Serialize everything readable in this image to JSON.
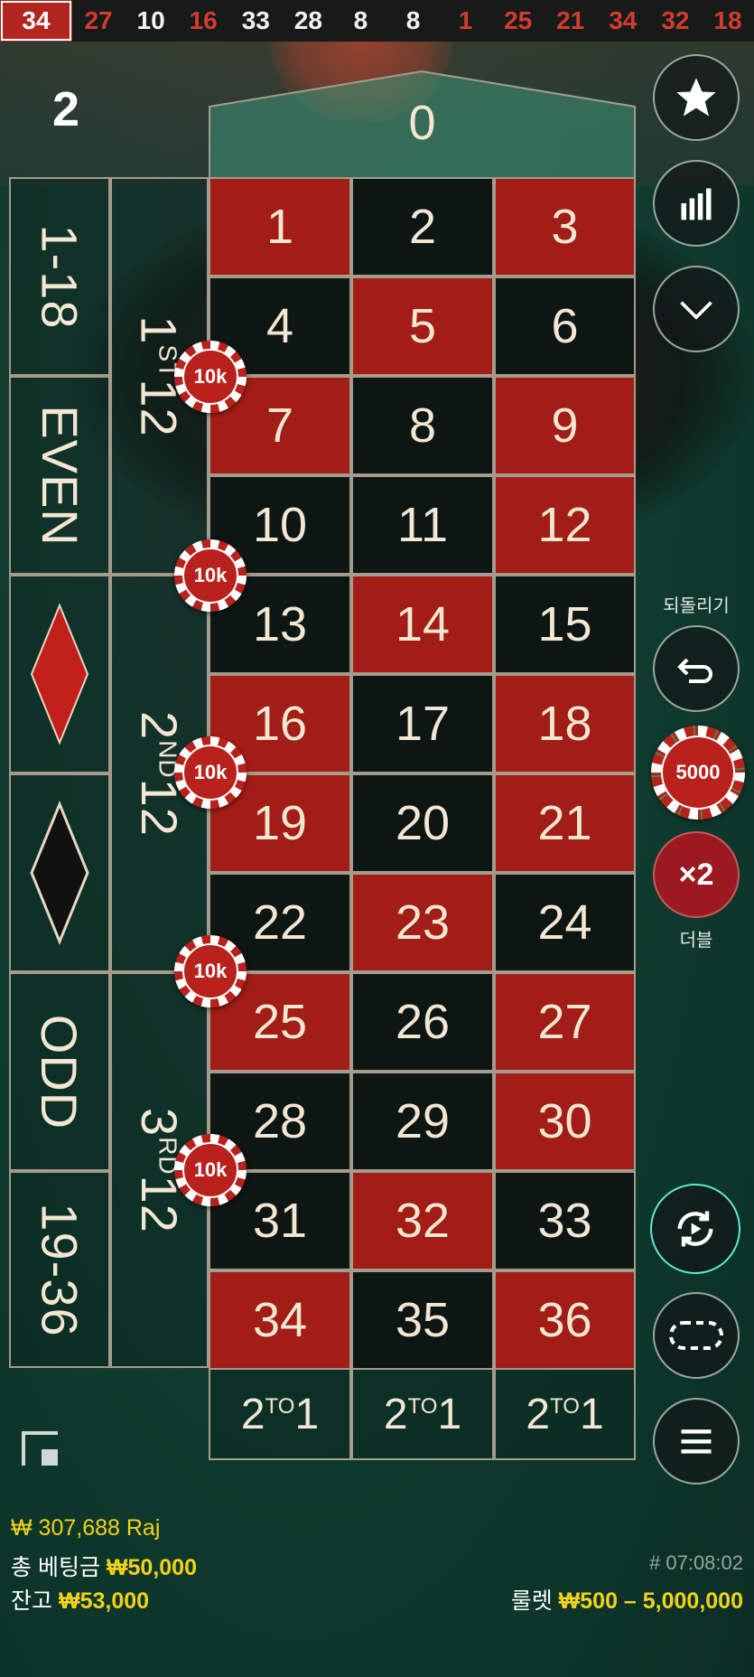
{
  "history": {
    "latest": "34",
    "numbers": [
      {
        "value": "27",
        "color": "red"
      },
      {
        "value": "10",
        "color": "black"
      },
      {
        "value": "16",
        "color": "red"
      },
      {
        "value": "33",
        "color": "black"
      },
      {
        "value": "28",
        "color": "black"
      },
      {
        "value": "8",
        "color": "black"
      },
      {
        "value": "8",
        "color": "black"
      },
      {
        "value": "1",
        "color": "red"
      },
      {
        "value": "25",
        "color": "red"
      },
      {
        "value": "21",
        "color": "red"
      },
      {
        "value": "34",
        "color": "red"
      },
      {
        "value": "32",
        "color": "red"
      },
      {
        "value": "18",
        "color": "red"
      }
    ]
  },
  "round_indicator": "2",
  "table": {
    "zero": "0",
    "numbers": [
      "1",
      "2",
      "3",
      "4",
      "5",
      "6",
      "7",
      "8",
      "9",
      "10",
      "11",
      "12",
      "13",
      "14",
      "15",
      "16",
      "17",
      "18",
      "19",
      "20",
      "21",
      "22",
      "23",
      "24",
      "25",
      "26",
      "27",
      "28",
      "29",
      "30",
      "31",
      "32",
      "33",
      "34",
      "35",
      "36"
    ],
    "outside": {
      "low": "1-18",
      "even": "EVEN",
      "odd": "ODD",
      "high": "19-36"
    },
    "dozens": {
      "first": {
        "num": "1",
        "sup": "ST",
        "tail": "12"
      },
      "second": {
        "num": "2",
        "sup": "ND",
        "tail": "12"
      },
      "third": {
        "num": "3",
        "sup": "RD",
        "tail": "12"
      }
    },
    "column_bet": {
      "a": "2",
      "sup": "TO",
      "b": "1"
    },
    "chip_label": "10k"
  },
  "controls": {
    "undo_label": "되돌리기",
    "chip_value": "5000",
    "double_symbol": "×2",
    "double_label": "더블"
  },
  "footer": {
    "balance_line": "₩ 307,688 Raj",
    "total_bet_label": "총 베팅금",
    "total_bet_value": "₩50,000",
    "balance_label": "잔고",
    "balance_value": "₩53,000",
    "round_id": "# 07:08:02",
    "limits_label": "룰렛",
    "limits_value": "₩500 – 5,000,000"
  },
  "colors": {
    "red": "#a11d16",
    "black": "#0d1613",
    "accent_yellow": "#f2d21a"
  }
}
